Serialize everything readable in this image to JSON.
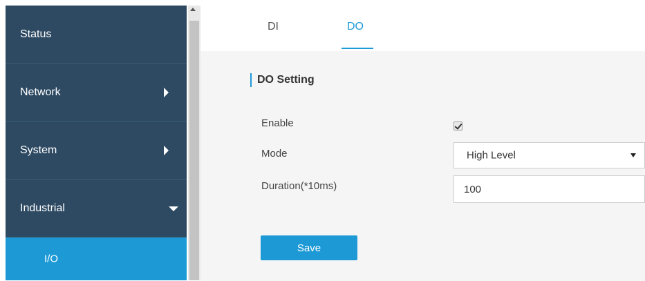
{
  "sidebar": {
    "items": [
      {
        "label": "Status"
      },
      {
        "label": "Network"
      },
      {
        "label": "System"
      },
      {
        "label": "Industrial"
      }
    ],
    "subitem": {
      "label": "I/O"
    }
  },
  "tabs": [
    {
      "label": "DI",
      "active": false
    },
    {
      "label": "DO",
      "active": true
    }
  ],
  "section": {
    "title": "DO Setting"
  },
  "form": {
    "enable": {
      "label": "Enable",
      "checked": true
    },
    "mode": {
      "label": "Mode",
      "value": "High Level"
    },
    "duration": {
      "label": "Duration(*10ms)",
      "value": "100"
    }
  },
  "save_label": "Save",
  "colors": {
    "sidebar_bg": "#2e4a63",
    "accent": "#1d9ad6",
    "content_bg": "#f5f5f5"
  }
}
